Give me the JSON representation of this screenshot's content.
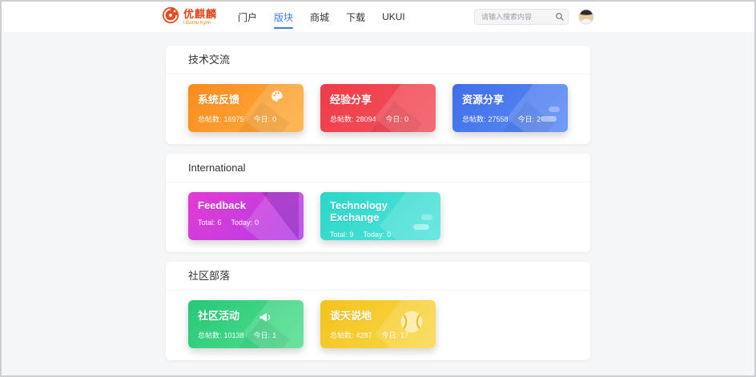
{
  "header": {
    "logo": {
      "title": "优麒麟",
      "subtitle": "Ubuntu Kylin"
    },
    "nav": [
      {
        "label": "门户"
      },
      {
        "label": "版块"
      },
      {
        "label": "商城"
      },
      {
        "label": "下载"
      },
      {
        "label": "UKUI"
      }
    ],
    "active_nav_index": 1,
    "accent_color": "#3c7bf6",
    "search": {
      "placeholder": "请输入搜索内容"
    },
    "icons": {
      "search": "search-icon",
      "avatar": "user-avatar",
      "logo": "ubuntu-kylin-logo-icon"
    }
  },
  "sections": [
    {
      "title": "技术交流",
      "cards": [
        {
          "name": "系统反馈",
          "total_label": "总帖数:",
          "total": "16975",
          "today_label": "今日:",
          "today": "0",
          "gradient": [
            "#fa8b1e",
            "#ffae3c"
          ],
          "icon": "palette-icon"
        },
        {
          "name": "经验分享",
          "total_label": "总帖数:",
          "total": "28094",
          "today_label": "今日:",
          "today": "0",
          "gradient": [
            "#ef3b47",
            "#f2545f"
          ]
        },
        {
          "name": "资源分享",
          "total_label": "总帖数:",
          "total": "27558",
          "today_label": "今日:",
          "today": "2",
          "gradient": [
            "#3f6ee8",
            "#5b8cf7"
          ]
        }
      ]
    },
    {
      "title": "International",
      "cards": [
        {
          "name": "Feedback",
          "total_label": "Total:",
          "total": "6",
          "today_label": "Today:",
          "today": "0",
          "gradient": [
            "#e43bd3",
            "#b13de8"
          ]
        },
        {
          "name": "Technology Exchange",
          "total_label": "Total:",
          "total": "9",
          "today_label": "Today:",
          "today": "0",
          "gradient": [
            "#2bd6c8",
            "#55e4dc"
          ]
        }
      ]
    },
    {
      "title": "社区部落",
      "cards": [
        {
          "name": "社区活动",
          "total_label": "总帖数:",
          "total": "10138",
          "today_label": "今日:",
          "today": "1",
          "gradient": [
            "#27c878",
            "#52e08e"
          ],
          "icon": "megaphone-icon"
        },
        {
          "name": "谈天说地",
          "total_label": "总帖数:",
          "total": "4287",
          "today_label": "今日:",
          "today": "17",
          "gradient": [
            "#f3c21c",
            "#f9d94a"
          ],
          "icon": "tennis-ball-icon"
        }
      ]
    }
  ]
}
